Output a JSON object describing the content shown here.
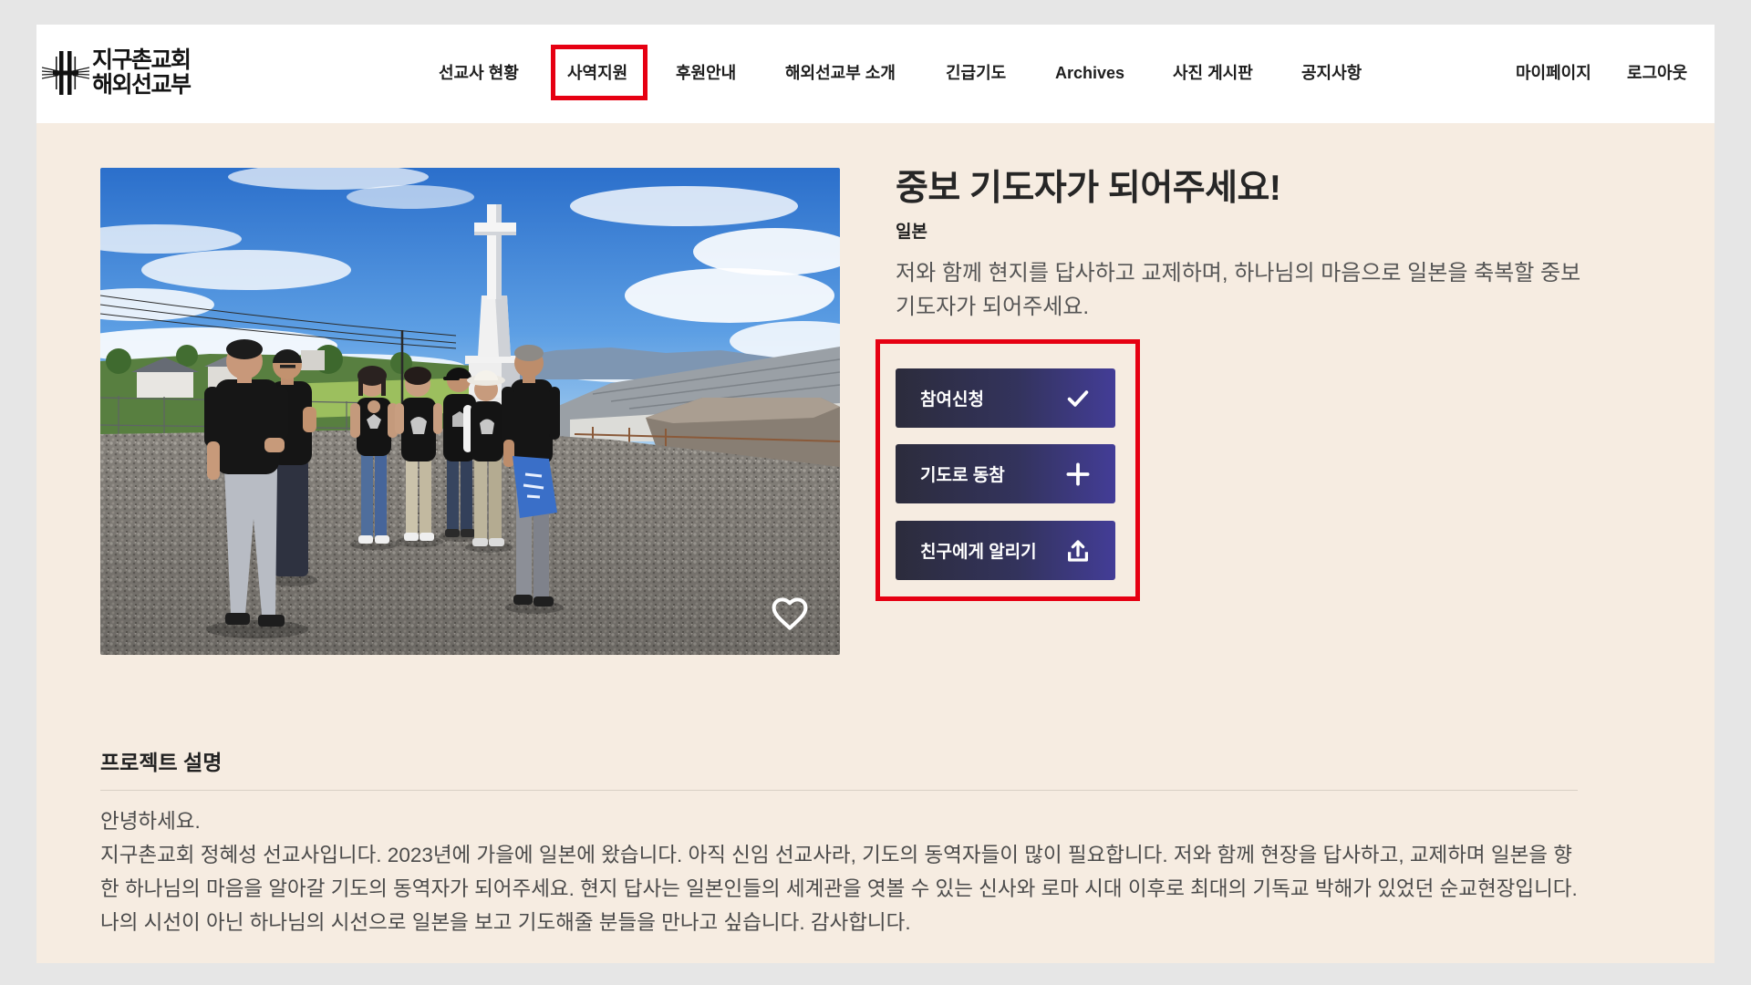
{
  "header": {
    "logo": {
      "line1": "지구촌교회",
      "line2": "해외선교부",
      "icon": "cross-logo-icon"
    },
    "nav": [
      {
        "label": "선교사 현황"
      },
      {
        "label": "사역지원",
        "highlighted": true
      },
      {
        "label": "후원안내"
      },
      {
        "label": "해외선교부 소개"
      },
      {
        "label": "긴급기도"
      },
      {
        "label": "Archives"
      },
      {
        "label": "사진 게시판"
      },
      {
        "label": "공지사항"
      }
    ],
    "user": {
      "mypage": "마이페이지",
      "logout": "로그아웃"
    }
  },
  "project": {
    "favorite_icon": "heart-icon",
    "title": "중보 기도자가 되어주세요!",
    "country": "일본",
    "summary": "저와 함께 현지를 답사하고 교제하며, 하나님의 마음으로 일본을 축복할 중보기도자가 되어주세요.",
    "actions": [
      {
        "label": "참여신청",
        "icon": "check-icon"
      },
      {
        "label": "기도로 동참",
        "icon": "plus-icon"
      },
      {
        "label": "친구에게 알리기",
        "icon": "share-icon"
      }
    ]
  },
  "description": {
    "heading": "프로젝트 설명",
    "greeting": "안녕하세요.",
    "body": "지구촌교회 정혜성 선교사입니다. 2023년에 가을에 일본에 왔습니다. 아직 신임 선교사라, 기도의 동역자들이 많이 필요합니다. 저와 함께 현장을 답사하고, 교제하며 일본을 향한 하나님의 마음을 알아갈 기도의 동역자가 되어주세요. 현지 답사는 일본인들의 세계관을 엿볼 수 있는 신사와 로마 시대 이후로 최대의 기독교 박해가 있었던 순교현장입니다. 나의 시선이 아닌 하나님의 시선으로 일본을 보고 기도해줄 분들을 만나고 싶습니다. 감사합니다."
  },
  "colors": {
    "page_background": "#f6ece1",
    "header_background": "#ffffff",
    "button_dark": "#2c2c3c",
    "button_accent": "#433d97",
    "annotation_highlight": "#e60012"
  }
}
